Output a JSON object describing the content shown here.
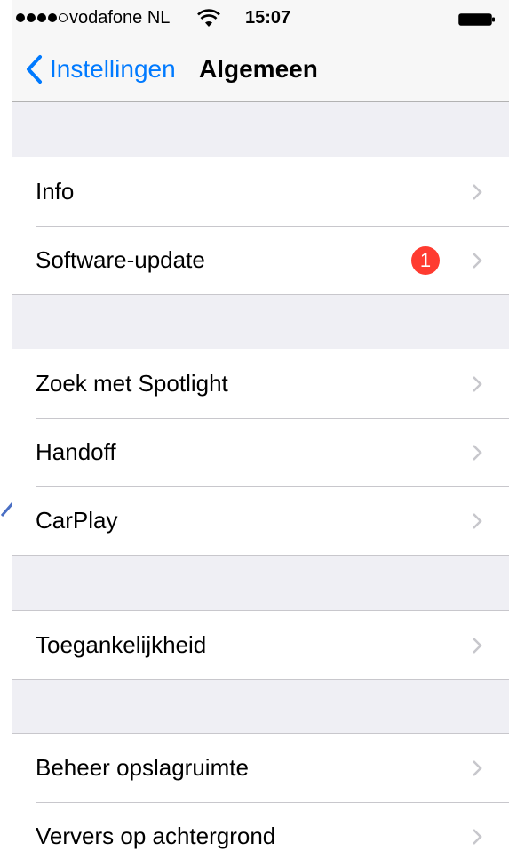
{
  "status_bar": {
    "carrier": "vodafone NL",
    "time": "15:07",
    "signal_bars_filled": 4,
    "signal_bars_total": 5
  },
  "nav": {
    "back_label": "Instellingen",
    "title": "Algemeen"
  },
  "groups": [
    {
      "rows": [
        {
          "label": "Info"
        },
        {
          "label": "Software-update",
          "badge": "1"
        }
      ]
    },
    {
      "rows": [
        {
          "label": "Zoek met Spotlight"
        },
        {
          "label": "Handoff"
        },
        {
          "label": "CarPlay"
        }
      ]
    },
    {
      "rows": [
        {
          "label": "Toegankelijkheid"
        }
      ]
    },
    {
      "rows": [
        {
          "label": "Beheer opslagruimte"
        },
        {
          "label": "Ververs op achtergrond"
        }
      ]
    }
  ],
  "colors": {
    "accent": "#007aff",
    "badge": "#ff3b30",
    "background": "#efeff4",
    "separator": "#c8c7cc",
    "chevron": "#c7c7cc",
    "annotation": "#4a6fc4"
  },
  "icons": {
    "back": "chevron-left-icon",
    "row": "chevron-right-icon",
    "wifi": "wifi-icon",
    "battery": "battery-icon"
  }
}
